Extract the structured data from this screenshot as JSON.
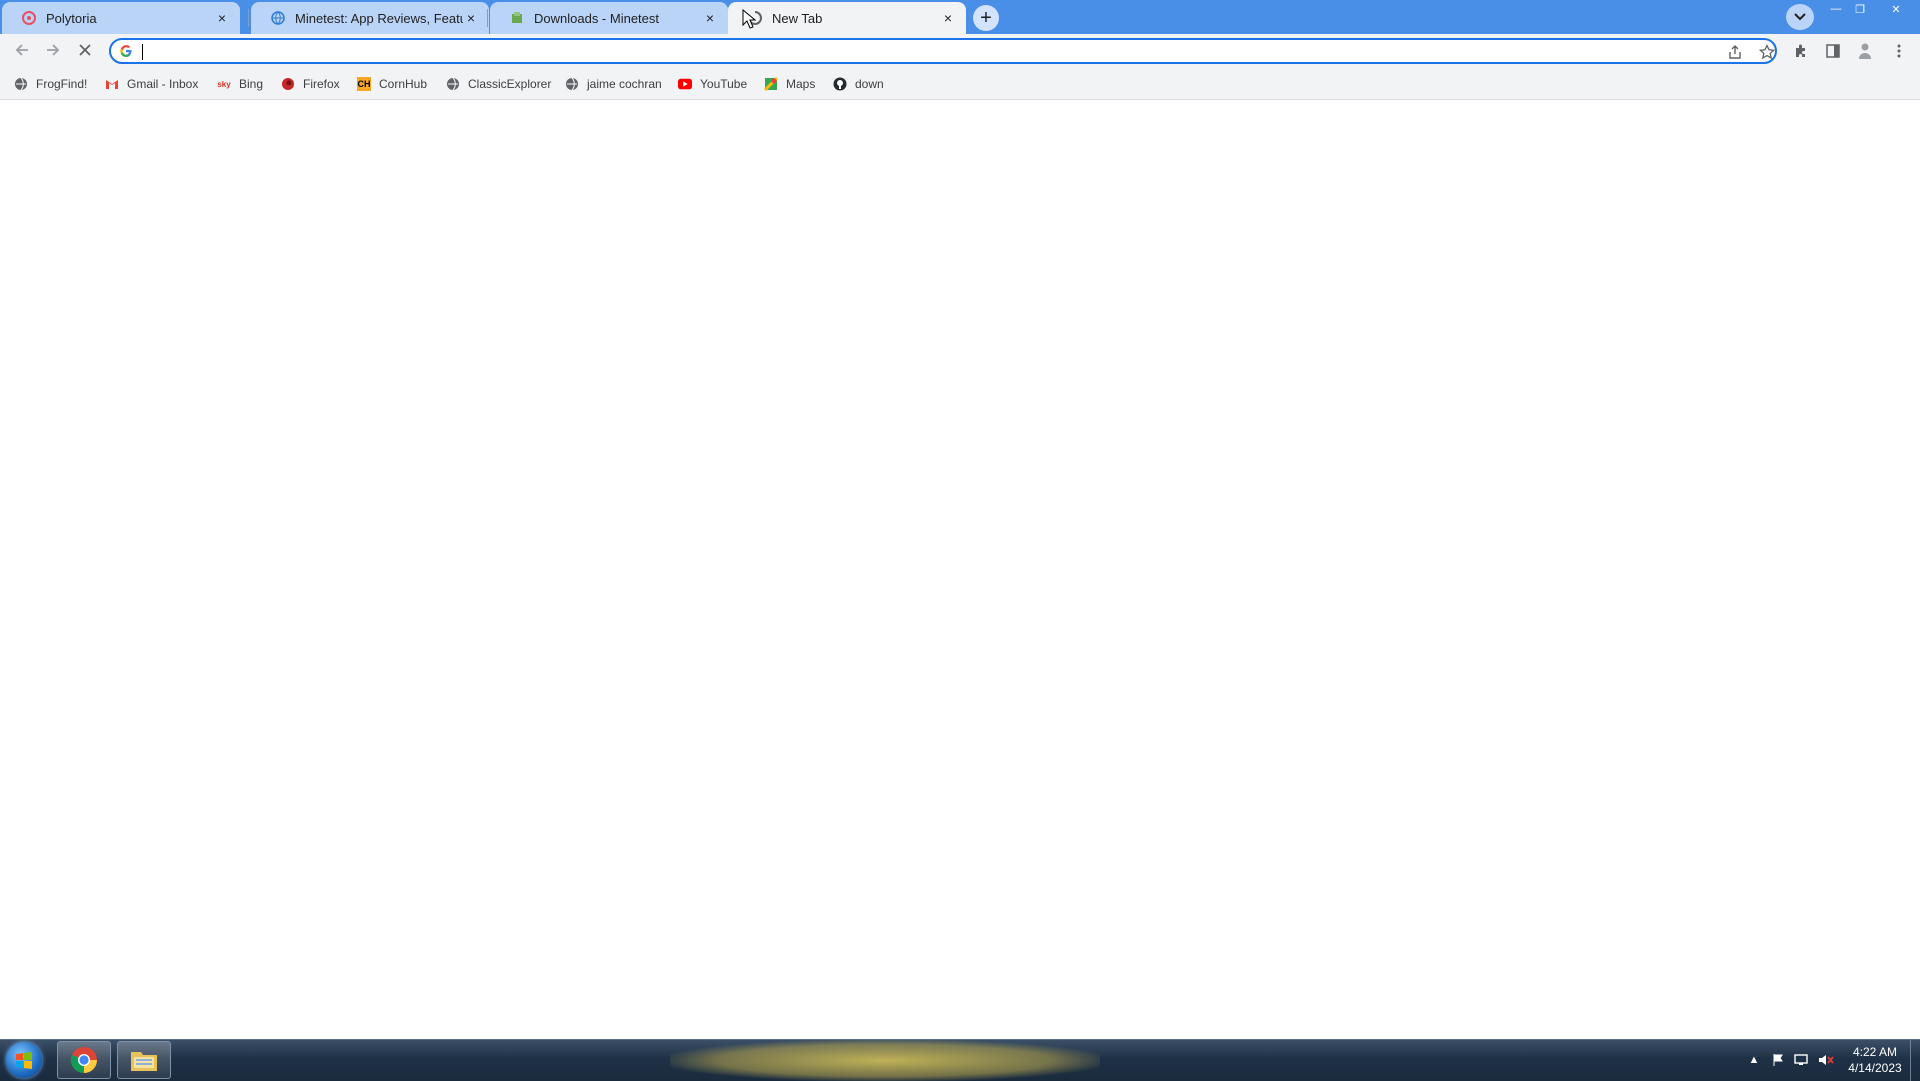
{
  "browser": {
    "tabs": [
      {
        "title": "Polytoria",
        "favicon": "polytoria-icon",
        "active": false
      },
      {
        "title": "Minetest: App Reviews, Features",
        "favicon": "globe-icon",
        "active": false
      },
      {
        "title": "Downloads - Minetest",
        "favicon": "minetest-icon",
        "active": false
      },
      {
        "title": "New Tab",
        "favicon": "loading-icon",
        "active": true
      }
    ],
    "close_glyph": "×",
    "new_tab_glyph": "+",
    "window_controls": {
      "minimize": "—",
      "restore": "❐",
      "close": "✕"
    }
  },
  "toolbar": {
    "omnibox_value": "",
    "omnibox_placeholder": ""
  },
  "bookmarks": [
    {
      "label": "FrogFind!",
      "icon": "globe-icon"
    },
    {
      "label": "Gmail - Inbox",
      "icon": "gmail-icon"
    },
    {
      "label": "Bing",
      "icon": "bing-icon"
    },
    {
      "label": "Firefox",
      "icon": "firefox-icon"
    },
    {
      "label": "CornHub",
      "icon": "cornhub-icon"
    },
    {
      "label": "ClassicExplorer",
      "icon": "globe-icon"
    },
    {
      "label": "jaime cochran",
      "icon": "globe-icon"
    },
    {
      "label": "YouTube",
      "icon": "youtube-icon"
    },
    {
      "label": "Maps",
      "icon": "maps-icon"
    },
    {
      "label": "down",
      "icon": "github-icon"
    }
  ],
  "taskbar": {
    "time": "4:22 AM",
    "date": "4/14/2023",
    "pinned": [
      "chrome-icon",
      "file-explorer-icon"
    ]
  },
  "colors": {
    "tabstrip": "#4a8fe7",
    "accent": "#1a73e8",
    "toolbar": "#f1f3f4"
  }
}
